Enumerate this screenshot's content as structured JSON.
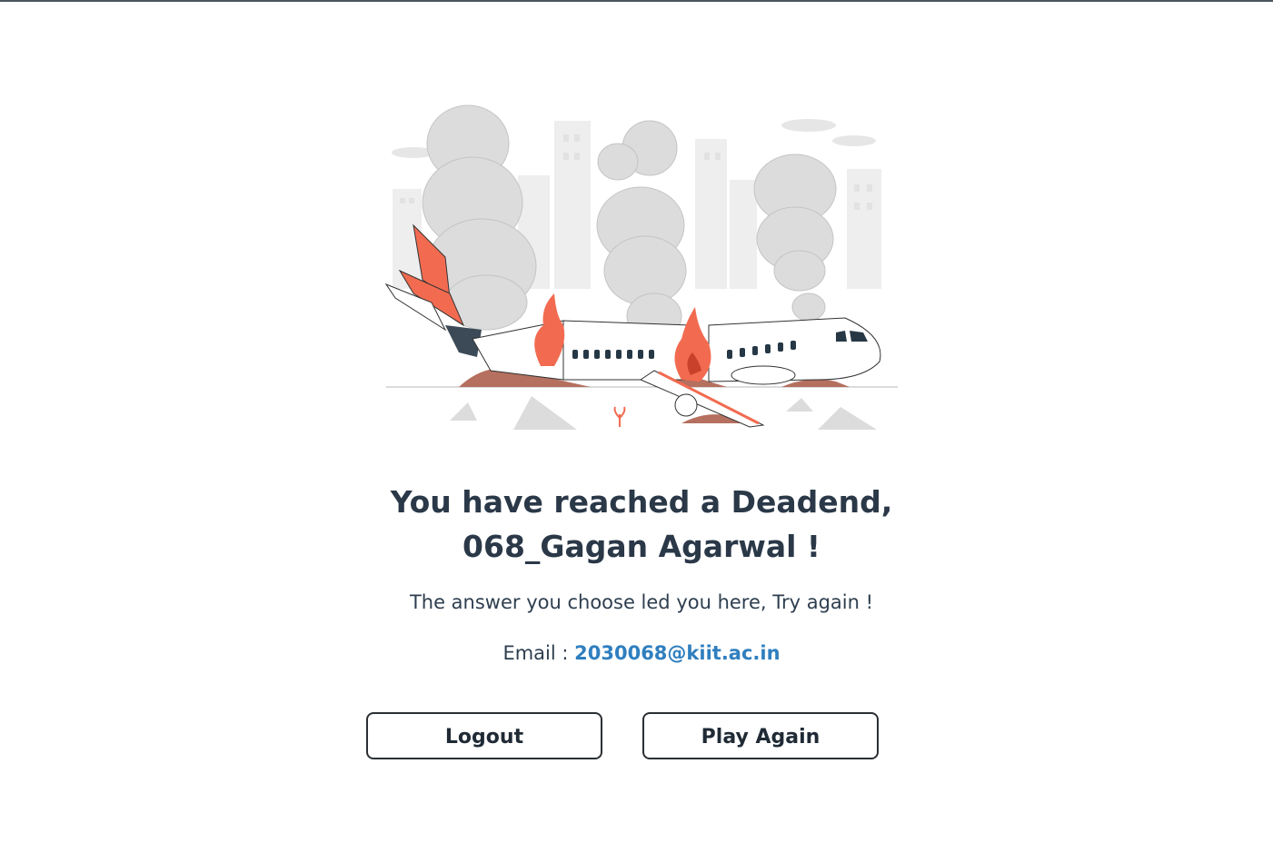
{
  "illustration": {
    "icon": "plane-crash-illustration",
    "colors": {
      "smoke": "#dcdcdc",
      "buildings": "#efefef",
      "fire": "#f26b50",
      "ground": "#b5705f",
      "plane": "#ffffff",
      "windows": "#263845"
    }
  },
  "heading": {
    "line1": "You have reached a Deadend,",
    "line2": "068_Gagan Agarwal !"
  },
  "message": "The answer you choose led you here, Try again !",
  "email": {
    "label": "Email : ",
    "value": "2030068@kiit.ac.in"
  },
  "buttons": {
    "logout": "Logout",
    "play_again": "Play Again"
  },
  "colors": {
    "heading": "#2a3848",
    "link": "#2f7fbf",
    "button_border": "#2b2f33"
  }
}
